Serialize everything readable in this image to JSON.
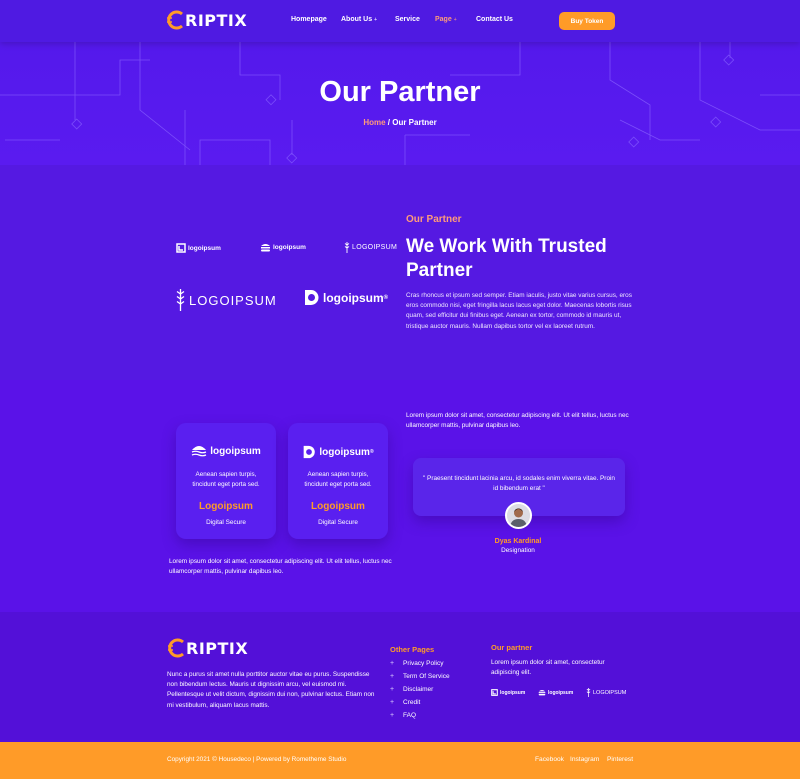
{
  "brand": {
    "name_prefix": "C",
    "name_rest": "RIPTIX"
  },
  "nav": {
    "items": [
      {
        "label": "Homepage"
      },
      {
        "label": "About Us",
        "caret": "+"
      },
      {
        "label": "Service"
      },
      {
        "label": "Page",
        "caret": "+"
      },
      {
        "label": "Contact Us"
      }
    ],
    "buy_label": "Buy Token"
  },
  "hero": {
    "title": "Our Partner",
    "breadcrumb_home": "Home",
    "breadcrumb_sep": " / ",
    "breadcrumb_current": "Our Partner"
  },
  "partner": {
    "eyebrow": "Our Partner",
    "title": "We Work With Trusted Partner",
    "text": "Cras rhoncus et ipsum sed semper. Etiam iaculis, justo vitae varius cursus, eros eros commodo nisi, eget fringilla lacus lacus eget dolor. Maecenas lobortis risus quam, sed efficitur dui finibus eget. Aenean ex tortor, commodo id mauris ut, tristique auctor mauris. Nullam dapibus tortor vel ex laoreet rutrum.",
    "logos": [
      {
        "label": "logoipsum",
        "icon": "square-mark-icon"
      },
      {
        "label": "logoipsum",
        "icon": "burger-stack-icon"
      },
      {
        "label": "LOGOIPSUM",
        "icon": "wheat-icon"
      },
      {
        "label": "LOGOIPSUM",
        "icon": "wheat-icon"
      },
      {
        "label": "logoipsum",
        "trademark": "®",
        "icon": "split-circle-icon"
      }
    ]
  },
  "testimonials": {
    "cards": [
      {
        "logo": "logoipsum",
        "text": "Aenean sapien turpis, tincidunt eget porta sed.",
        "name": "Logoipsum",
        "role": "Digital Secure",
        "icon": "waves-icon"
      },
      {
        "logo": "logoipsum",
        "trademark": "®",
        "text": "Aenean sapien turpis, tincidunt eget porta sed.",
        "name": "Logoipsum",
        "role": "Digital Secure",
        "icon": "split-circle-icon"
      }
    ],
    "left_text": "Lorem ipsum dolor sit amet, consectetur adipiscing elit. Ut elit tellus, luctus nec ullamcorper mattis, pulvinar dapibus leo.",
    "right_text": "Lorem ipsum dolor sit amet, consectetur adipiscing elit. Ut elit tellus, luctus nec ullamcorper mattis, pulvinar dapibus leo.",
    "quote": "\" Praesent tincidunt lacinia arcu, id sodales enim viverra vitae. Proin id bibendum erat \"",
    "person_name": "Dyas Kardinal",
    "person_role": "Designation"
  },
  "footer": {
    "about": "Nunc a purus sit amet nulla porttitor auctor vitae eu purus. Suspendisse non bibendum lectus. Mauris ut dignissim arcu, vel euismod mi. Pellentesque ut velit dictum, dignissim dui non, pulvinar lectus. Etiam non mi vestibulum, aliquam lacus mattis.",
    "other_pages_title": "Other Pages",
    "other_pages": [
      "Privacy Policy",
      "Term Of Service",
      "Disclaimer",
      "Credit",
      "FAQ"
    ],
    "partner_title": "Our partner",
    "partner_text": "Lorem ipsum dolor sit amet, consectetur adipiscing elit.",
    "partner_logos": [
      "logoipsum",
      "logoipsum",
      "LOGOIPSUM"
    ],
    "copyright": "Copyright 2021 © Housedeco | Powered by Rometheme Studio",
    "social": [
      "Facebook",
      "Instagram",
      "Pinterest"
    ]
  },
  "colors": {
    "accent": "#ff9b28",
    "accent_soft": "#ff9b7a",
    "bg": "#5519e2"
  }
}
